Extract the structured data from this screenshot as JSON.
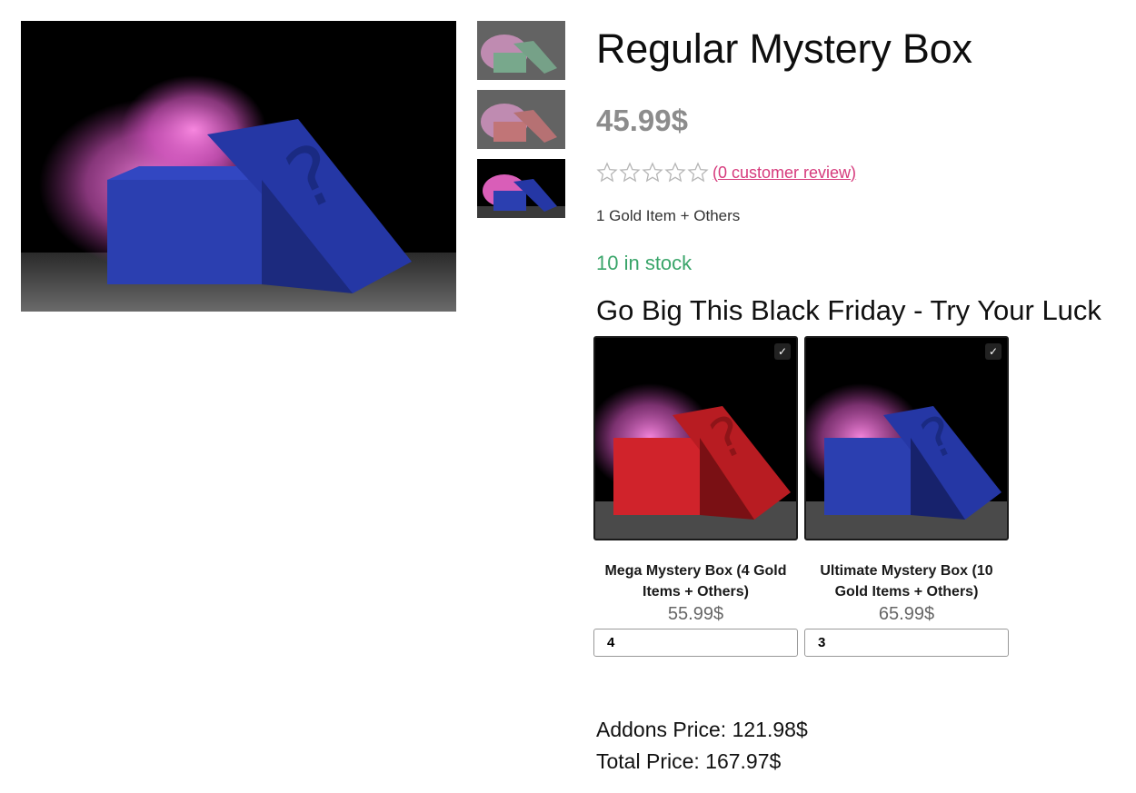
{
  "product": {
    "title": "Regular Mystery Box",
    "price": "45.99$",
    "review_link": "(0 customer review)",
    "short_description": "1 Gold Item + Others",
    "stock": "10 in stock",
    "rating": 0,
    "rating_max": 5
  },
  "gallery": {
    "main_image_icon": "mystery-box-blue",
    "thumbnails": [
      {
        "icon": "mystery-box-green",
        "color": "#2f9a5c"
      },
      {
        "icon": "mystery-box-red",
        "color": "#d0282d"
      },
      {
        "icon": "mystery-box-blue",
        "color": "#2c3fa8"
      }
    ]
  },
  "addons": {
    "heading": "Go Big This Black Friday - Try Your Luck",
    "items": [
      {
        "name": "Mega Mystery Box (4 Gold Items + Others)",
        "price": "55.99$",
        "quantity": "4",
        "color": "#d0232b",
        "checked": true
      },
      {
        "name": "Ultimate Mystery Box (10 Gold Items + Others)",
        "price": "65.99$",
        "quantity": "3",
        "color": "#2c3fa8",
        "checked": true
      }
    ]
  },
  "totals": {
    "addons_label": "Addons Price:",
    "addons_value": "121.98$",
    "total_label": "Total Price:",
    "total_value": "167.97$"
  },
  "colors": {
    "price": "#8c8c8c",
    "review_link": "#d63a7c",
    "stock": "#3aa56a",
    "smoke": "#ff6fd8"
  }
}
